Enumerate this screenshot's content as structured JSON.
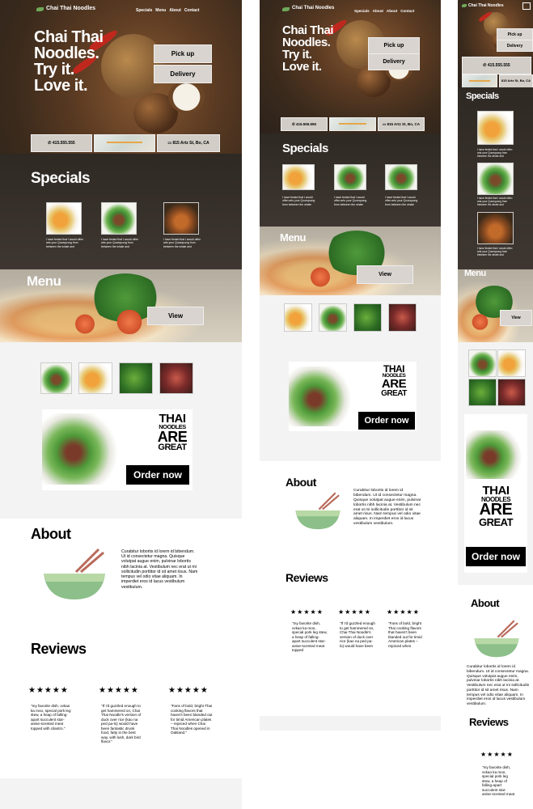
{
  "brand": "Chai Thai Noodles",
  "nav": [
    "Specials",
    "Menu",
    "About",
    "Contact"
  ],
  "nav_mid": [
    "Specials",
    "About",
    "About",
    "Contact"
  ],
  "headline": [
    "Chai Thai",
    "Noodles.",
    "Try it.",
    "Love it."
  ],
  "buttons": {
    "pickup": "Pick up",
    "delivery": "Delivery",
    "view": "View",
    "order": "Order now"
  },
  "contact": {
    "phone": "415.555.555",
    "address": "815 Artz St, Bo, CA"
  },
  "sections": {
    "specials": "Specials",
    "menu": "Menu",
    "about": "About",
    "reviews": "Reviews"
  },
  "special_desc": "I have fested that I would offen arts your Quoequong from between the whale and",
  "special_desc_mid": "I have fested that I would offen arts your Quoequong from between the whale",
  "thai_graphic": {
    "line1": "THAI",
    "line2": "NOODLES",
    "line3": "ARE",
    "line4": "GREAT"
  },
  "about_text": "Curabitur lobortis id lorem id bibendum. Ut id consectetur magna. Quisque volutpat augue enim, pulvinar lobortis nibh lacinia at. Vestibulum nec erat ut mi sollicitudin porttitor id sit amet risus. Nam tempus vel odio vitae aliquam. In imperdiet eros id lacus vestibulum vestibulum.",
  "stars": "★★★★★",
  "reviews": [
    "\"my favorite dish, vvkao ka moo, special pork leg stew, a heap of falling-apart succulent star-anise-scented meat topped with cilantro.\"",
    "\"If I'd guzzled enough to get hammered on, Chai Thai Noodle's version of duck over rice (kao na ped pa-lo) would have been fantastic drunk food, fatty in the best way, with lush, dark bird flavor.\"",
    "\"Fans of bold, bright Thai cooking flavors that haven't been blanded out for timid American plates – rejoiced when Chai Thai Noodles opened in Oakland.\""
  ],
  "reviews_mid": [
    "\"my favorite dish, vvkao ka moo, special pork leg stew, a heap of falling-apart succulent star-anise-scented meat topped",
    "\"If I'd guzzled enough to get hammered on, Chai Thai Noodle's version of duck over rice (kao na ped pa-lo) would have been",
    "\"Fans of bold, bright Thai cooking flavors that haven't been blanded out for timid American plates – rejoiced when"
  ],
  "review_mobile": "\"my favorite dish, vvkao ka moo, special pork leg stew, a heap of falling-apart succulent star-anise-scented meat"
}
